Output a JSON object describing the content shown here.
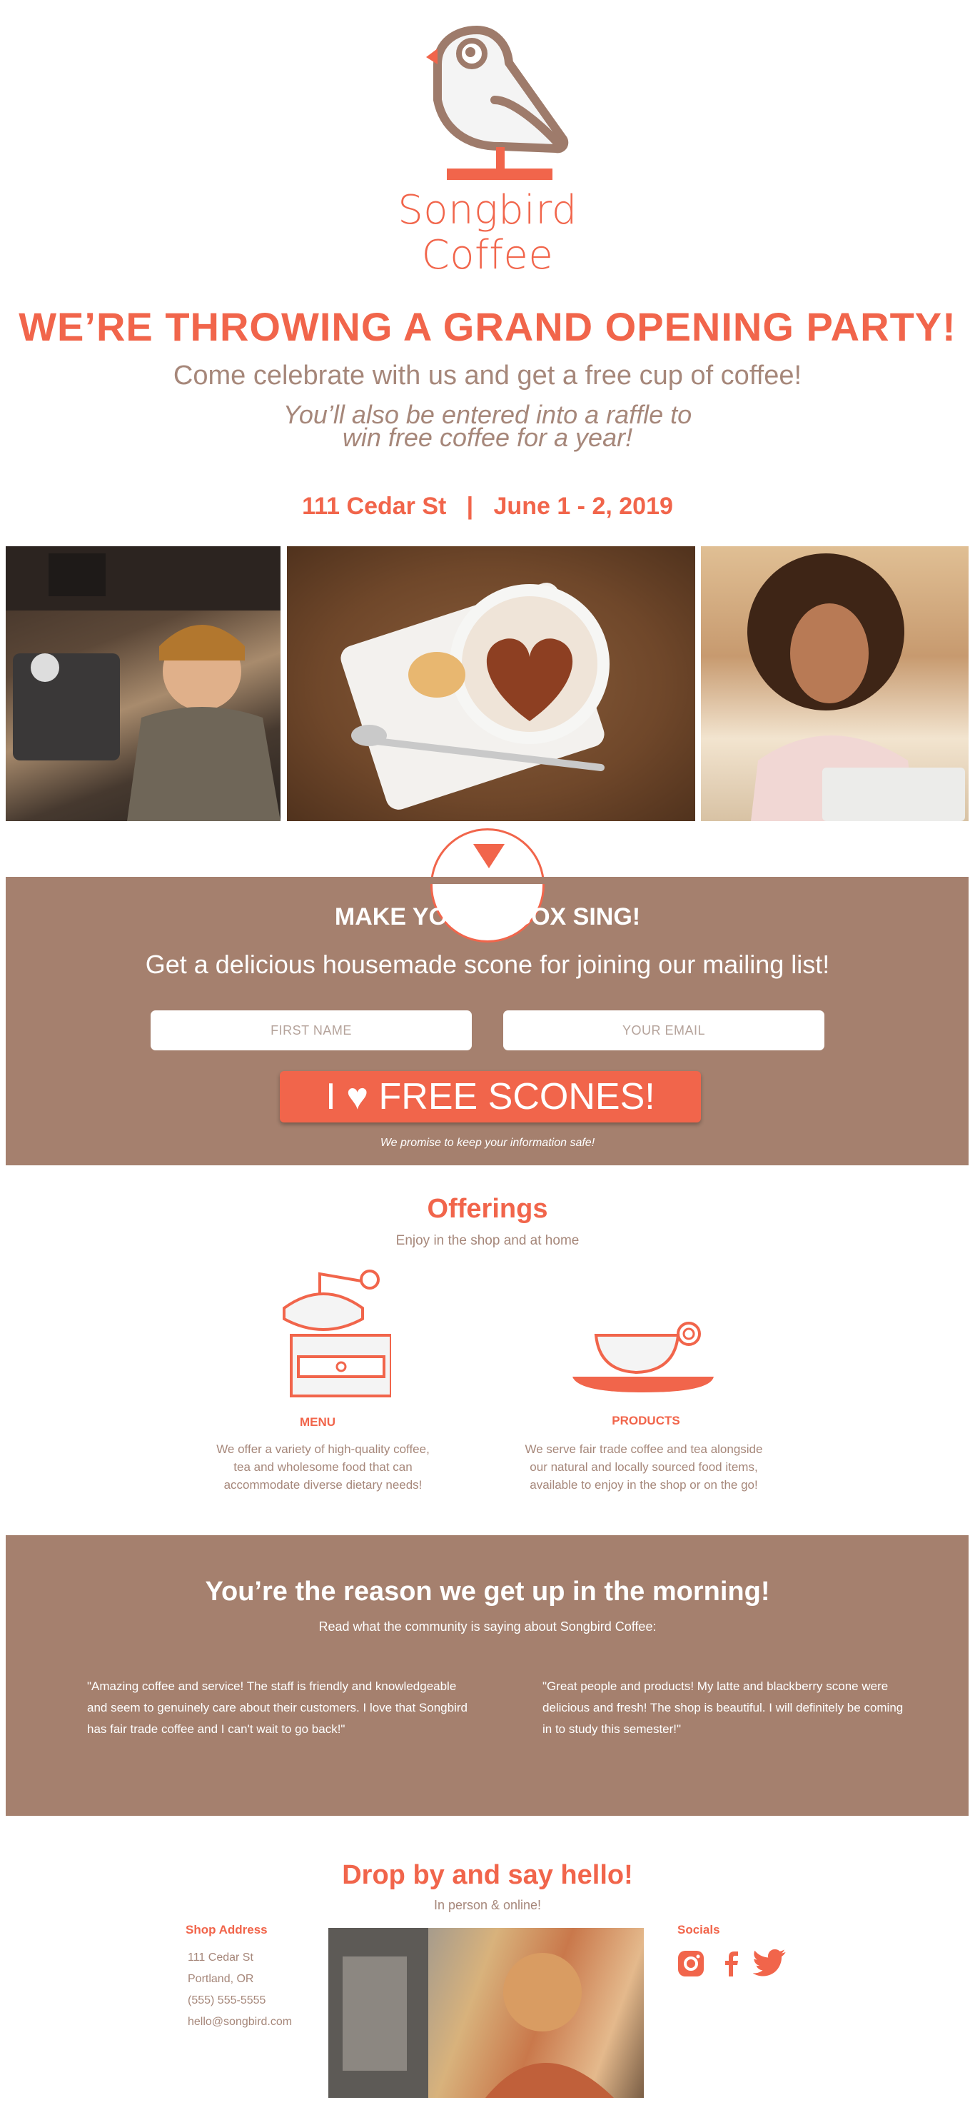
{
  "brand": {
    "name_line1": "Songbird",
    "name_line2": "Coffee"
  },
  "colors": {
    "accent": "#f1654b",
    "band": "#a5806e",
    "muted_text": "#a6877a"
  },
  "hero": {
    "headline": "WE’RE THROWING A GRAND OPENING PARTY!",
    "subhead": "Come celebrate with us and get a free cup of coffee!",
    "raffle_line1": "You’ll also be entered into a raffle to",
    "raffle_line2": "win free coffee for a year!",
    "event_info": "111 Cedar St   |   June 1 - 2, 2019"
  },
  "subscribe": {
    "title": "MAKE YOUR INBOX SING!",
    "text": "Get a delicious housemade scone for joining our mailing list!",
    "first_name_placeholder": "FIRST NAME",
    "email_placeholder": "YOUR EMAIL",
    "button_label": "I ♥ FREE SCONES!",
    "promise": "We promise to keep your information safe!"
  },
  "offerings": {
    "title": "Offerings",
    "subtitle": "Enjoy in the shop and at home",
    "menu": {
      "label": "MENU",
      "description": "We offer a variety of high-quality coffee, tea and wholesome food that can accommodate diverse dietary needs!"
    },
    "products": {
      "label": "PRODUCTS",
      "description": "We serve fair trade coffee and tea alongside our natural and locally sourced food items, available to enjoy in the shop or on the go!"
    }
  },
  "testimonials": {
    "title": "You’re the reason we get up in the morning!",
    "subtitle": "Read what the community is saying about Songbird Coffee:",
    "quotes": [
      "\"Amazing coffee and service!  The staff is friendly and knowledgeable and seem to genuinely care about their customers.  I love that Songbird has fair trade coffee and I can't wait to go back!\"",
      "\"Great people and products!  My latte and blackberry scone were delicious and fresh! The shop is beautiful.  I will definitely be coming in to study this semester!\""
    ]
  },
  "contact": {
    "title": "Drop by and say hello!",
    "subtitle": "In person & online!",
    "address_heading": "Shop Address",
    "address_lines": [
      "111 Cedar St",
      "Portland, OR",
      "(555) 555-5555",
      "hello@songbird.com"
    ],
    "socials_heading": "Socials",
    "social_icons": [
      "instagram-icon",
      "facebook-icon",
      "twitter-icon"
    ]
  }
}
